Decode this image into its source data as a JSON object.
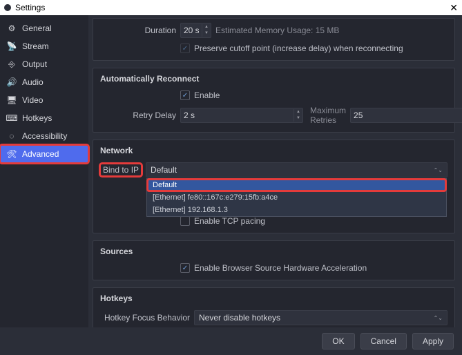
{
  "window": {
    "title": "Settings"
  },
  "sidebar": {
    "items": [
      {
        "label": "General"
      },
      {
        "label": "Stream"
      },
      {
        "label": "Output"
      },
      {
        "label": "Audio"
      },
      {
        "label": "Video"
      },
      {
        "label": "Hotkeys"
      },
      {
        "label": "Accessibility"
      },
      {
        "label": "Advanced"
      }
    ]
  },
  "delay": {
    "duration_label": "Duration",
    "duration_value": "20 s",
    "memory_hint": "Estimated Memory Usage: 15 MB",
    "preserve_label": "Preserve cutoff point (increase delay) when reconnecting"
  },
  "reconnect": {
    "title": "Automatically Reconnect",
    "enable_label": "Enable",
    "retry_delay_label": "Retry Delay",
    "retry_delay_value": "2 s",
    "max_retries_label": "Maximum Retries",
    "max_retries_value": "25"
  },
  "network": {
    "title": "Network",
    "bind_label": "Bind to IP",
    "bind_value": "Default",
    "options": [
      "Default",
      "[Ethernet] fe80::167c:e279:15fb:a4ce",
      "[Ethernet] 192.168.1.3"
    ],
    "tcp_pacing_label": "Enable TCP pacing"
  },
  "sources": {
    "title": "Sources",
    "browser_hw_label": "Enable Browser Source Hardware Acceleration"
  },
  "hotkeys": {
    "title": "Hotkeys",
    "focus_label": "Hotkey Focus Behavior",
    "focus_value": "Never disable hotkeys"
  },
  "footer": {
    "ok": "OK",
    "cancel": "Cancel",
    "apply": "Apply"
  }
}
